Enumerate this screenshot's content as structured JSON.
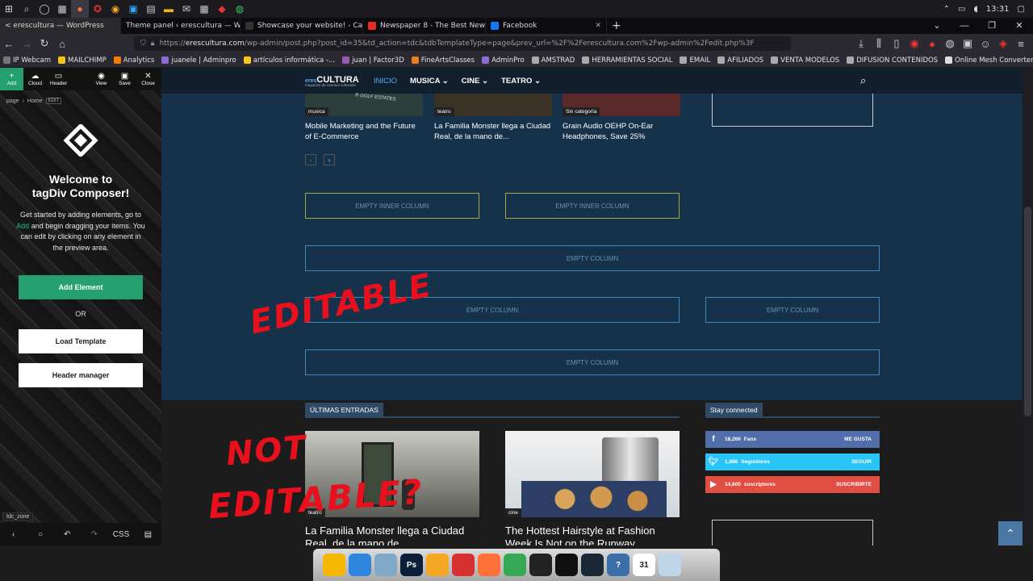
{
  "tray": {
    "time": "13:31"
  },
  "tabs": [
    {
      "label": "< erescultura — WordPress",
      "color": "#3c7ac0"
    },
    {
      "label": "Theme panel ‹ erescultura — Word",
      "color": "#3c7ac0"
    },
    {
      "label": "Showcase your website! - Call f",
      "color": "#222222"
    },
    {
      "label": "Newspaper 8 - The Best News W",
      "color": "#e52d27"
    },
    {
      "label": "Facebook",
      "color": "#1877f2"
    }
  ],
  "nav": {
    "url_prefix": "https://",
    "url_host": "erescultura.com",
    "url_path": "/wp-admin/post.php?post_id=35&td_action=tdc&tdbTemplateType=page&prev_url=%2F%2Ferescultura.com%2Fwp-admin%2Fedit.php%3F"
  },
  "bookmarks": [
    {
      "label": "IP Webcam",
      "color": "#777777"
    },
    {
      "label": "MAILCHIMP",
      "color": "#f0c419"
    },
    {
      "label": "Analytics",
      "color": "#f57c00"
    },
    {
      "label": "juanele | Adminpro",
      "color": "#8e6bd3"
    },
    {
      "label": "artículos informática -...",
      "color": "#f5c518"
    },
    {
      "label": "juan | Factor3D",
      "color": "#9b59b6"
    },
    {
      "label": "FineArtsClasses",
      "color": "#e67e22"
    },
    {
      "label": "AdminPro",
      "color": "#8e6bd3"
    },
    {
      "label": "AMSTRAD",
      "color": "#aaaaaa"
    },
    {
      "label": "HERRAMIENTAS SOCIAL",
      "color": "#aaaaaa"
    },
    {
      "label": "EMAIL",
      "color": "#aaaaaa"
    },
    {
      "label": "AFILIADOS",
      "color": "#aaaaaa"
    },
    {
      "label": "VENTA MODELOS",
      "color": "#aaaaaa"
    },
    {
      "label": "DIFUSION CONTENIDOS",
      "color": "#aaaaaa"
    },
    {
      "label": "Online Mesh Converter",
      "color": "#dddddd"
    },
    {
      "label": "YouTube",
      "color": "#ff0000"
    }
  ],
  "composer": {
    "toolbar": {
      "add": "Add",
      "cloud": "Cloud",
      "header": "Header",
      "view": "View",
      "save": "Save",
      "close": "Close"
    },
    "breadcrumb": {
      "page": "page",
      "home": "Home",
      "edit": "EDIT"
    },
    "welcome_line1": "Welcome to",
    "welcome_line2": "tagDiv Composer!",
    "desc_before": "Get started by adding elements, go to",
    "desc_link": "Add",
    "desc_after": "and begin dragging your items. You can edit by clicking on any element in the preview area.",
    "add_element": "Add Element",
    "or": "OR",
    "load_template": "Load Template",
    "header_manager": "Header manager",
    "zone_label": "tdc_zone",
    "bottom": {
      "css": "CSS"
    }
  },
  "site": {
    "brand_prefix": "eres",
    "brand_main": "CULTURA",
    "brand_tagline": "magazine de eventos culturales",
    "menu": [
      "INICIO",
      "MUSICA",
      "CINE",
      "TEATRO"
    ],
    "news": [
      {
        "category": "musica",
        "title": "Mobile Marketing and the Future of E-Commerce",
        "thumb_text": "R GOLF ESTATES"
      },
      {
        "category": "teatro",
        "title": "La Familia Monster llega a Ciudad Real, de la mano de..."
      },
      {
        "category": "Sin categoría",
        "title": "Grain Audio OEHP On-Ear Headphones, Save 25%"
      }
    ],
    "empty_inner_column": "EMPTY INNER COLUMN",
    "empty_column": "EMPTY COLUMN",
    "latest_heading": "ÚLTIMAS ENTRADAS",
    "stay_heading": "Stay connected",
    "posts": [
      {
        "category": "teatro",
        "title": "La Familia Monster llega a Ciudad Real, de la mano de..."
      },
      {
        "category": "cine",
        "title": "The Hottest Hairstyle at Fashion Week Is Not on the Runway"
      }
    ],
    "social": [
      {
        "count": "18,266",
        "label": "Fans",
        "action": "ME GUSTA",
        "color": "#516eab"
      },
      {
        "count": "1,886",
        "label": "Seguidores",
        "action": "SEGUIR",
        "color": "#29c5f6"
      },
      {
        "count": "14,600",
        "label": "suscriptores",
        "action": "SUSCRIBIRTE",
        "color": "#e14e42"
      }
    ]
  },
  "annotations": {
    "editable": "EDITABLE",
    "not": "NOT",
    "not_editable": "EDITABLE?"
  },
  "dock": [
    {
      "name": "files",
      "color": "#f5b700"
    },
    {
      "name": "downloads",
      "color": "#2e86de"
    },
    {
      "name": "archive",
      "color": "#7fa8c9"
    },
    {
      "name": "photoshop",
      "color": "#0b1f3a",
      "label": "Ps"
    },
    {
      "name": "norton",
      "color": "#f5a623"
    },
    {
      "name": "sketchup",
      "color": "#d63031"
    },
    {
      "name": "firefox",
      "color": "#ff7139"
    },
    {
      "name": "chrome",
      "color": "#34a853"
    },
    {
      "name": "obs",
      "color": "#222222"
    },
    {
      "name": "unity",
      "color": "#111111"
    },
    {
      "name": "steam",
      "color": "#1b2838"
    },
    {
      "name": "help",
      "color": "#3c6ea8",
      "label": "?"
    },
    {
      "name": "calendar",
      "color": "#ffffff",
      "label": "31"
    },
    {
      "name": "recycle-bin",
      "color": "#bfd6ea"
    }
  ]
}
